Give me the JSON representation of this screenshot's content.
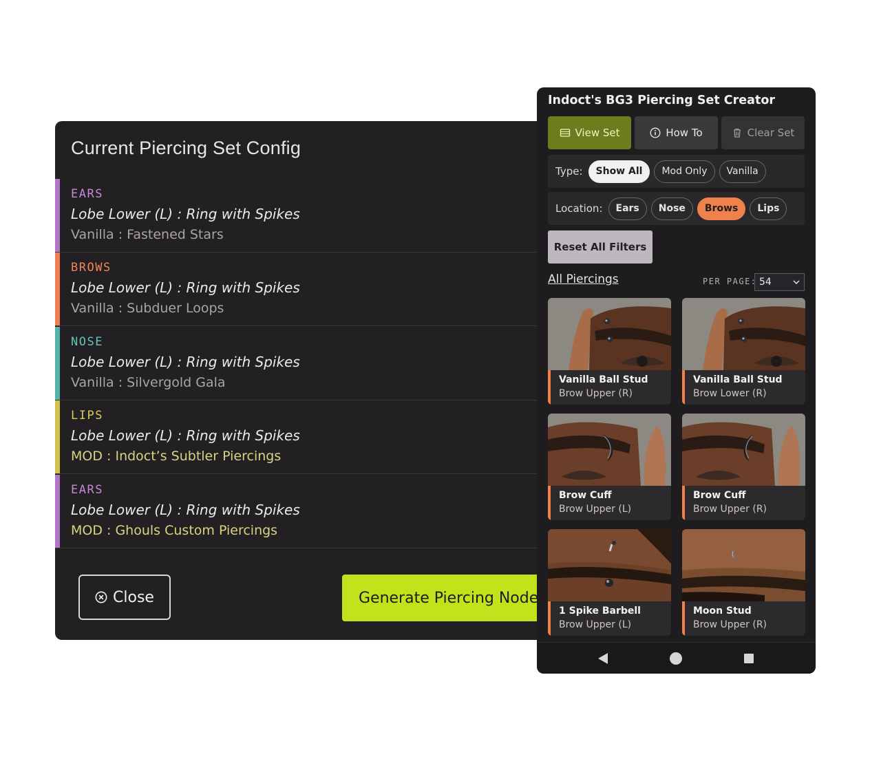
{
  "config": {
    "title": "Current Piercing Set Config",
    "entries": [
      {
        "category": "EARS",
        "piercing": "Lobe Lower (L) : Ring with Spikes",
        "source": "Vanilla : Fastened Stars",
        "color": "#b177c6",
        "mod": false
      },
      {
        "category": "BROWS",
        "piercing": "Lobe Lower (L) : Ring with Spikes",
        "source": "Vanilla : Subduer Loops",
        "color": "#ef7f4f",
        "mod": false
      },
      {
        "category": "NOSE",
        "piercing": "Lobe Lower (L) : Ring with Spikes",
        "source": "Vanilla : Silvergold Gala",
        "color": "#56b1a7",
        "mod": false
      },
      {
        "category": "LIPS",
        "piercing": "Lobe Lower (L) : Ring with Spikes",
        "source": "MOD : Indoct’s Subtler Piercings",
        "color": "#d2c24c",
        "mod": true
      },
      {
        "category": "EARS",
        "piercing": "Lobe Lower (L) : Ring with Spikes",
        "source": "MOD : Ghouls Custom Piercings",
        "color": "#b177c6",
        "mod": true
      }
    ],
    "close_label": "Close",
    "generate_label": "Generate Piercing Nodes"
  },
  "app": {
    "title": "Indoct's BG3 Piercing Set Creator",
    "toolbar": {
      "view_set": "View Set",
      "how_to": "How To",
      "clear_set": "Clear Set"
    },
    "type_filter": {
      "label": "Type:",
      "options": [
        "Show All",
        "Mod Only",
        "Vanilla"
      ],
      "selected": "Show All"
    },
    "location_filter": {
      "label": "Location:",
      "options": [
        "Ears",
        "Nose",
        "Brows",
        "Lips"
      ],
      "selected": "Brows"
    },
    "reset_label": "Reset All Filters",
    "list_title": "All Piercings",
    "per_page_label": "PER PAGE:",
    "per_page_value": "54",
    "cards": [
      {
        "name": "Vanilla Ball Stud",
        "location": "Brow Upper (R)"
      },
      {
        "name": "Vanilla Ball Stud",
        "location": "Brow Lower (R)"
      },
      {
        "name": "Brow Cuff",
        "location": "Brow Upper (L)"
      },
      {
        "name": "Brow Cuff",
        "location": "Brow Upper (R)"
      },
      {
        "name": "1 Spike Barbell",
        "location": "Brow Upper (L)"
      },
      {
        "name": "Moon Stud",
        "location": "Brow Upper (R)"
      }
    ],
    "colors": {
      "accent_green": "#c3e21c",
      "view_set_bg": "#6b7d1c",
      "brows_orange": "#f0814d"
    },
    "nav_icons": [
      "back-icon",
      "home-icon",
      "recents-icon"
    ]
  }
}
